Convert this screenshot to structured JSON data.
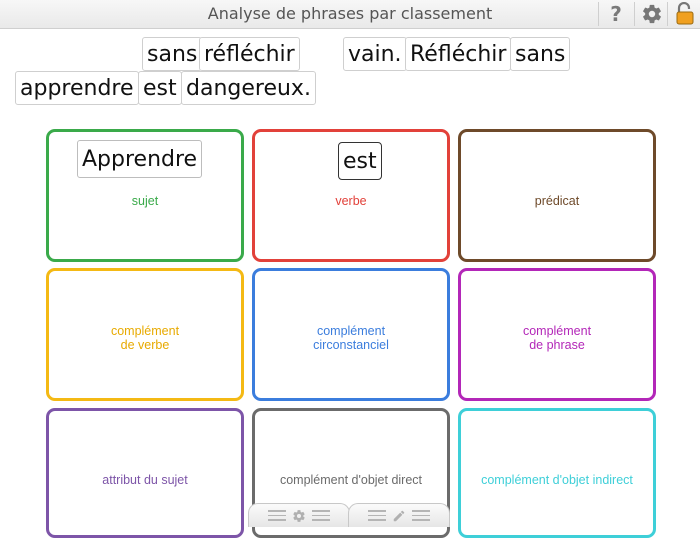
{
  "app": {
    "title": "Analyse de phrases par classement"
  },
  "toolbar": {
    "help_icon": "question-mark-icon",
    "help_label": "?",
    "settings_icon": "gear-icon",
    "lock_icon": "unlocked-padlock-icon"
  },
  "word_bank": [
    "sans",
    "réfléchir",
    "vain.",
    "Réfléchir",
    "sans",
    "apprendre",
    "est",
    "dangereux."
  ],
  "categories": [
    {
      "label": "sujet",
      "color": "#3aaa4a",
      "placed": "Apprendre"
    },
    {
      "label": "verbe",
      "color": "#e2413a",
      "placed": "est"
    },
    {
      "label": "prédicat",
      "color": "#6e4a2a",
      "placed": ""
    },
    {
      "label": "complément\nde verbe",
      "color": "#f4b914",
      "placed": ""
    },
    {
      "label": "complément\ncirconstanciel",
      "color": "#3b7ddd",
      "placed": ""
    },
    {
      "label": "complément\nde phrase",
      "color": "#b327b8",
      "placed": ""
    },
    {
      "label": "attribut du sujet",
      "color": "#7d55a8",
      "placed": ""
    },
    {
      "label": "complément d'objet direct",
      "color": "#6b6b6b",
      "placed": ""
    },
    {
      "label": "complément d'objet indirect",
      "color": "#3ecfd8",
      "placed": ""
    }
  ],
  "bottom_tabs": [
    {
      "name": "settings-tab",
      "icon": "gear-icon"
    },
    {
      "name": "edit-tab",
      "icon": "pencil-icon"
    }
  ]
}
